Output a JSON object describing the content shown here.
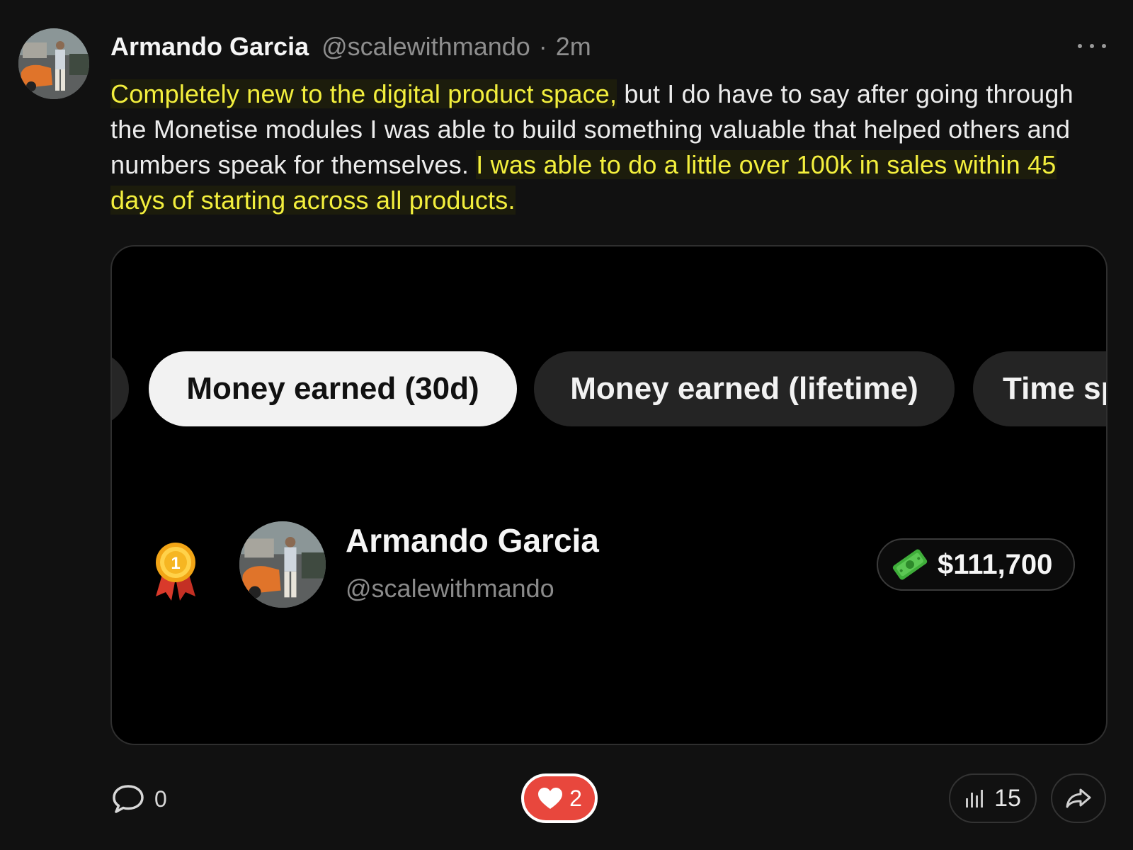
{
  "post": {
    "author_name": "Armando Garcia",
    "author_handle": "@scalewithmando",
    "separator": "·",
    "timestamp": "2m",
    "more_icon": "more-horizontal-icon",
    "text": {
      "part1": "Completely new to the digital product space,",
      "part2": " but I do have to say after going through the Monetise modules I was able to build something valuable that helped others and numbers speak for themselves. ",
      "part3": "I was able to do a little over 100k in sales within 45 days of starting across all products."
    }
  },
  "card": {
    "tabs": [
      {
        "label": "Money earned (30d)",
        "active": true
      },
      {
        "label": "Money earned (lifetime)",
        "active": false
      },
      {
        "label": "Time sp",
        "active": false
      }
    ],
    "leader": {
      "rank_icon": "first-place-medal-icon",
      "rank": "1",
      "name": "Armando Garcia",
      "handle": "@scalewithmando",
      "amount_icon": "money-bill-icon",
      "amount": "$111,700"
    }
  },
  "actions": {
    "comments": "0",
    "likes": "2",
    "views": "15",
    "icons": {
      "comment": "speech-bubble-icon",
      "like": "heart-icon",
      "views": "bar-chart-icon",
      "share": "share-arrow-icon"
    }
  },
  "colors": {
    "background": "#111111",
    "highlight_text": "#f3ef3d",
    "like_red": "#e8473d",
    "active_tab": "#f2f2f2",
    "money_green": "#4caf50"
  }
}
